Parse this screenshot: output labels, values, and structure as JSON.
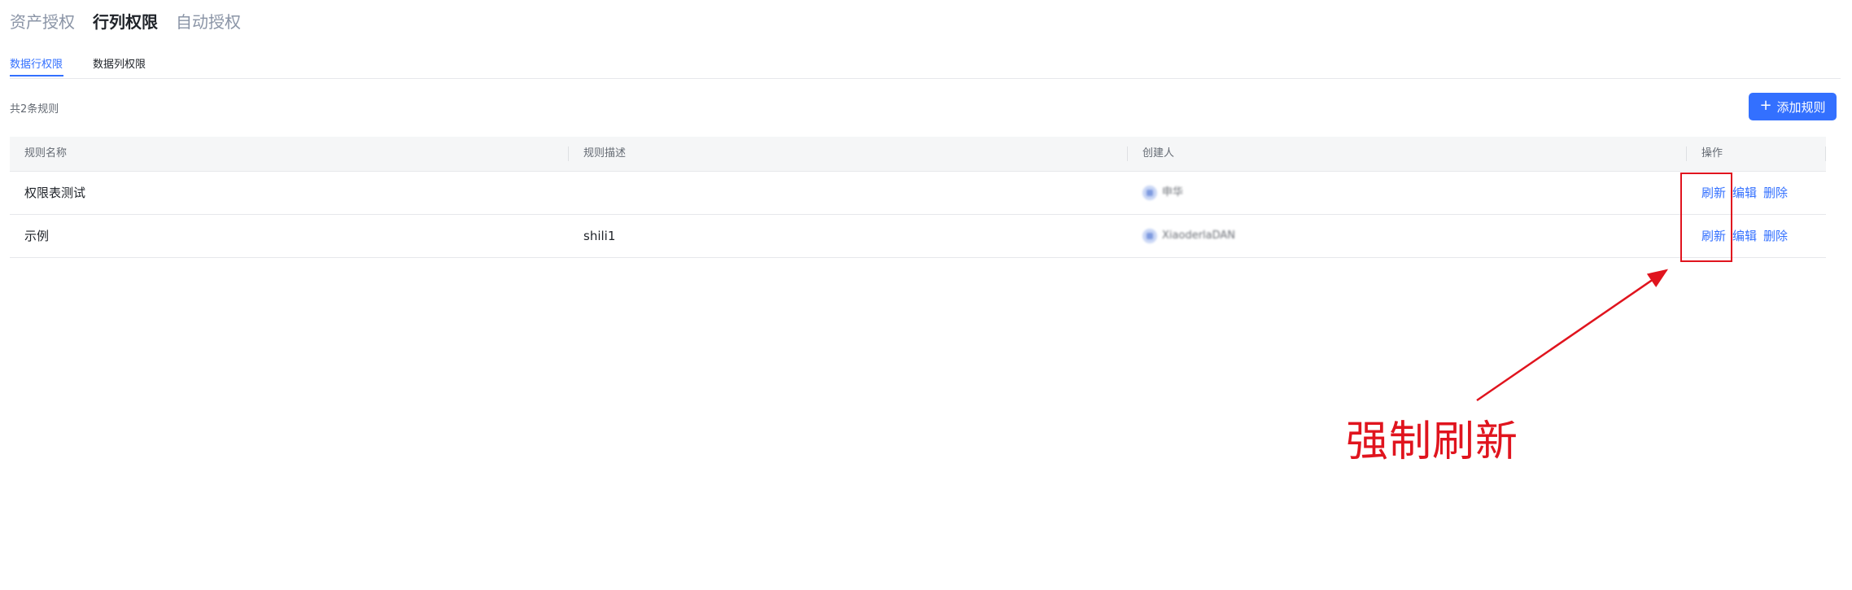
{
  "top_tabs": [
    {
      "label": "资产授权",
      "active": false
    },
    {
      "label": "行列权限",
      "active": true
    },
    {
      "label": "自动授权",
      "active": false
    }
  ],
  "sub_tabs": [
    {
      "label": "数据行权限",
      "active": true
    },
    {
      "label": "数据列权限",
      "active": false
    }
  ],
  "toolbar": {
    "total_text": "共2条规则",
    "add_button_label": "添加规则",
    "add_icon": "plus-icon"
  },
  "table": {
    "headers": [
      "规则名称",
      "规则描述",
      "创建人",
      "操作"
    ],
    "rows": [
      {
        "name": "权限表测试",
        "description": "",
        "creator": "申华",
        "actions": [
          "刷新",
          "编辑",
          "删除"
        ]
      },
      {
        "name": "示例",
        "description": "shili1",
        "creator": "XiaoderlaDAN",
        "actions": [
          "刷新",
          "编辑",
          "删除"
        ]
      }
    ]
  },
  "annotation": {
    "text": "强制刷新",
    "color": "#e0141e"
  },
  "colors": {
    "accent": "#3370ff",
    "annotation": "#e0141e"
  }
}
